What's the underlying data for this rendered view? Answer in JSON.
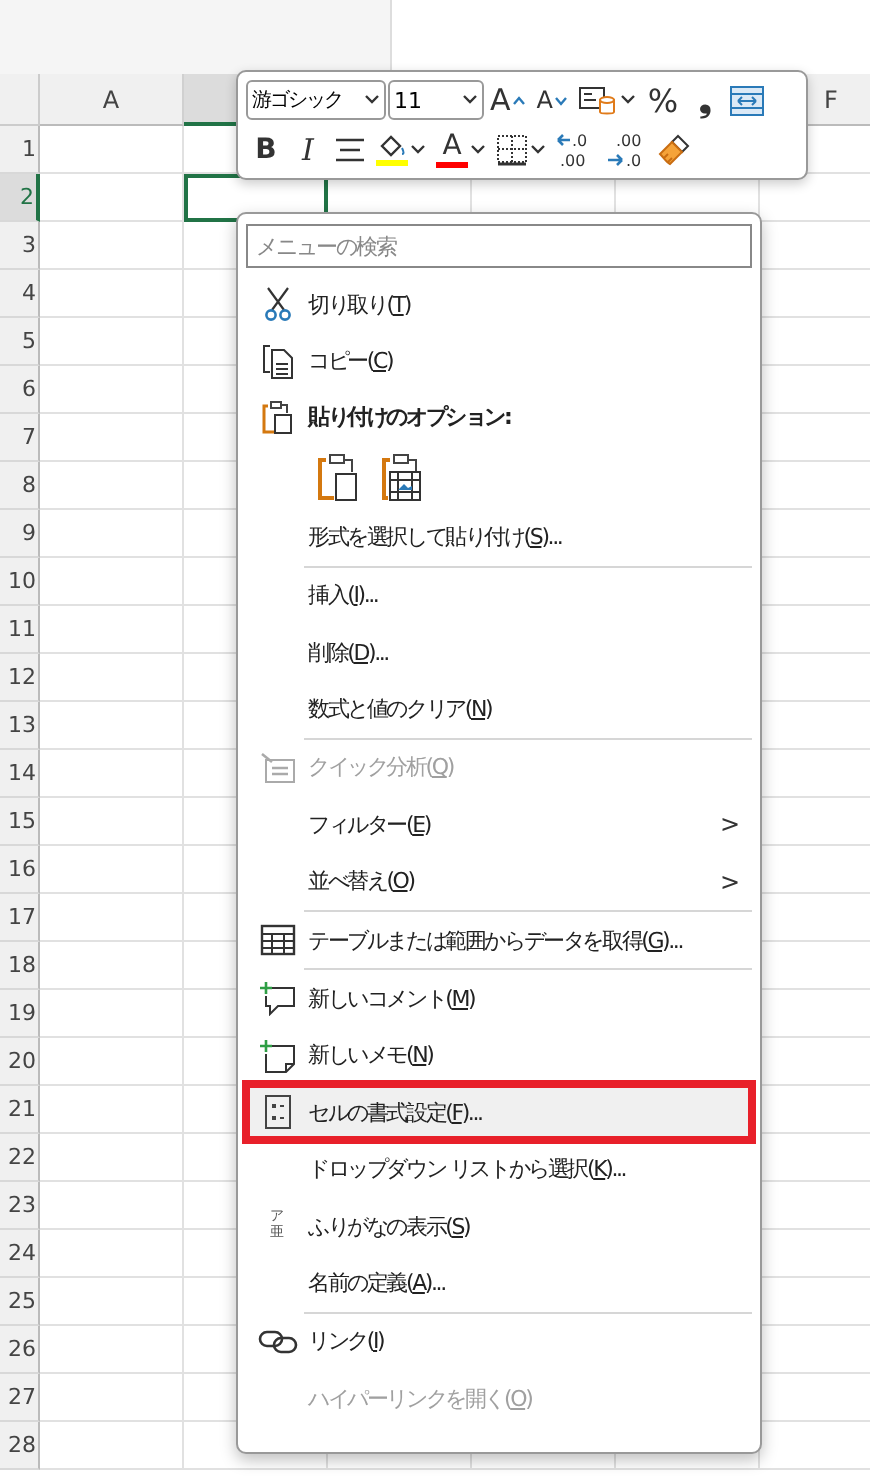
{
  "sheet": {
    "columns": [
      {
        "label": "A",
        "selected": false
      },
      {
        "selected": true
      },
      {},
      {},
      {},
      {
        "label": "F",
        "selected": false
      }
    ],
    "rows": [
      {
        "label": "1",
        "selected": false
      },
      {
        "label": "2",
        "selected": true
      },
      {
        "label": "3",
        "selected": false
      },
      {
        "label": "4",
        "selected": false
      },
      {
        "label": "5",
        "selected": false
      },
      {
        "label": "6",
        "selected": false
      },
      {
        "label": "7",
        "selected": false
      },
      {
        "label": "8",
        "selected": false
      },
      {
        "label": "9",
        "selected": false
      },
      {
        "label": "10",
        "selected": false
      },
      {
        "label": "11",
        "selected": false
      },
      {
        "label": "12",
        "selected": false
      },
      {
        "label": "13",
        "selected": false
      },
      {
        "label": "14",
        "selected": false
      },
      {
        "label": "15",
        "selected": false
      },
      {
        "label": "16",
        "selected": false
      },
      {
        "label": "17",
        "selected": false
      },
      {
        "label": "18",
        "selected": false
      },
      {
        "label": "19",
        "selected": false
      },
      {
        "label": "20",
        "selected": false
      },
      {
        "label": "21",
        "selected": false
      },
      {
        "label": "22",
        "selected": false
      },
      {
        "label": "23",
        "selected": false
      },
      {
        "label": "24",
        "selected": false
      },
      {
        "label": "25",
        "selected": false
      },
      {
        "label": "26",
        "selected": false
      },
      {
        "label": "27",
        "selected": false
      },
      {
        "label": "28",
        "selected": false
      }
    ]
  },
  "mini_toolbar": {
    "row_1": [
      {
        "kind": "font_select",
        "value": "游ゴシック"
      },
      {
        "kind": "size_select",
        "value": "11"
      },
      {
        "kind": "grow",
        "glyph": "A"
      },
      {
        "kind": "shrink",
        "glyph": "A"
      },
      {
        "kind": "cellstyle"
      },
      {
        "kind": "glyph",
        "glyph": "%"
      },
      {
        "kind": "glyph",
        "glyph": "❟"
      },
      {
        "kind": "wrap"
      }
    ],
    "row_2": [
      {
        "kind": "bold",
        "glyph": "B"
      },
      {
        "kind": "italic",
        "glyph": "I"
      },
      {
        "kind": "align"
      },
      {
        "kind": "fill",
        "color": "#ffff00"
      },
      {
        "kind": "fontcolor",
        "glyph": "A",
        "color": "#ff0000"
      },
      {
        "kind": "borders"
      },
      {
        "kind": "decimal_more",
        "lines": [
          ".0",
          ".00"
        ]
      },
      {
        "kind": "decimal_less",
        "lines": [
          ".00",
          ".0"
        ]
      },
      {
        "kind": "painter"
      }
    ]
  },
  "context_menu": {
    "search": {
      "placeholder": "メニューの検索"
    },
    "entries": [
      {
        "kind": "item",
        "before": "切り取り(",
        "accel": "T",
        "after": ")",
        "disabled": false,
        "selected": false,
        "callout": false
      },
      {
        "kind": "item",
        "before": "コピー(",
        "accel": "C",
        "after": ")",
        "disabled": false,
        "selected": false,
        "callout": false
      },
      {
        "kind": "header",
        "text": "貼り付けのオプション:"
      },
      {
        "kind": "paste_icons"
      },
      {
        "kind": "item",
        "before": "形式を選択して貼り付け(",
        "accel": "S",
        "after": ")...",
        "disabled": false,
        "selected": false,
        "callout": false
      },
      {
        "kind": "separator"
      },
      {
        "kind": "item",
        "before": "挿入(",
        "accel": "I",
        "after": ")...",
        "disabled": false,
        "selected": false,
        "callout": false
      },
      {
        "kind": "item",
        "before": "削除(",
        "accel": "D",
        "after": ")...",
        "disabled": false,
        "selected": false,
        "callout": false
      },
      {
        "kind": "item",
        "before": "数式と値のクリア(",
        "accel": "N",
        "after": ")",
        "disabled": false,
        "selected": false,
        "callout": false
      },
      {
        "kind": "separator"
      },
      {
        "kind": "item",
        "before": "クイック分析(",
        "accel": "Q",
        "after": ")",
        "disabled": true,
        "selected": false,
        "callout": false
      },
      {
        "kind": "item",
        "before": "フィルター(",
        "accel": "E",
        "after": ")",
        "arrow": ">",
        "disabled": false,
        "selected": false,
        "callout": false
      },
      {
        "kind": "item",
        "before": "並べ替え(",
        "accel": "O",
        "after": ")",
        "arrow": ">",
        "disabled": false,
        "selected": false,
        "callout": false
      },
      {
        "kind": "separator"
      },
      {
        "kind": "item",
        "before": "テーブルまたは範囲からデータを取得(",
        "accel": "G",
        "after": ")...",
        "disabled": false,
        "selected": false,
        "callout": false
      },
      {
        "kind": "separator"
      },
      {
        "kind": "item",
        "before": "新しいコメント(",
        "accel": "M",
        "after": ")",
        "disabled": false,
        "selected": false,
        "callout": false
      },
      {
        "kind": "item",
        "before": "新しいメモ(",
        "accel": "N",
        "after": ")",
        "disabled": false,
        "selected": false,
        "callout": false
      },
      {
        "kind": "item",
        "before": "セルの書式設定(",
        "accel": "F",
        "after": ")...",
        "disabled": false,
        "selected": true,
        "callout": true
      },
      {
        "kind": "item",
        "before": "ドロップダウン リストから選択(",
        "accel": "K",
        "after": ")...",
        "disabled": false,
        "selected": false,
        "callout": false
      },
      {
        "kind": "item",
        "icon_text": [
          "ア",
          "亜"
        ],
        "before": "ふりがなの表示(",
        "accel": "S",
        "after": ")",
        "disabled": false,
        "selected": false,
        "callout": false
      },
      {
        "kind": "item",
        "before": "名前の定義(",
        "accel": "A",
        "after": ")...",
        "disabled": false,
        "selected": false,
        "callout": false
      },
      {
        "kind": "separator"
      },
      {
        "kind": "item",
        "before": "リンク(",
        "accel": "I",
        "after": ")",
        "disabled": false,
        "selected": false,
        "callout": false
      },
      {
        "kind": "item",
        "before": "ハイパーリンクを開く(",
        "accel": "O",
        "after": ")",
        "disabled": true,
        "selected": false,
        "callout": false
      }
    ]
  }
}
